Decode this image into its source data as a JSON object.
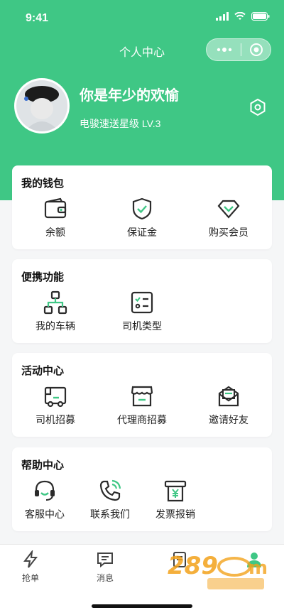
{
  "status": {
    "time": "9:41"
  },
  "header": {
    "title": "个人中心"
  },
  "profile": {
    "name": "你是年少的欢愉",
    "level": "电骏速送星级 LV.3"
  },
  "wallet": {
    "title": "我的钱包",
    "items": [
      {
        "label": "余额",
        "icon": "wallet-icon"
      },
      {
        "label": "保证金",
        "icon": "shield-check-icon"
      },
      {
        "label": "购买会员",
        "icon": "diamond-icon"
      }
    ]
  },
  "tools": {
    "title": "便携功能",
    "items": [
      {
        "label": "我的车辆",
        "icon": "org-chart-icon"
      },
      {
        "label": "司机类型",
        "icon": "checklist-icon"
      }
    ]
  },
  "events": {
    "title": "活动中心",
    "items": [
      {
        "label": "司机招募",
        "icon": "truck-icon"
      },
      {
        "label": "代理商招募",
        "icon": "store-icon"
      },
      {
        "label": "邀请好友",
        "icon": "mail-icon"
      }
    ]
  },
  "help": {
    "title": "帮助中心",
    "items": [
      {
        "label": "客服中心",
        "icon": "headset-icon"
      },
      {
        "label": "联系我们",
        "icon": "phone-icon"
      },
      {
        "label": "发票报销",
        "icon": "invoice-icon"
      }
    ]
  },
  "tabs": [
    {
      "label": "抢单",
      "icon": "lightning-icon"
    },
    {
      "label": "消息",
      "icon": "message-icon"
    },
    {
      "label": "",
      "icon": "document-icon"
    },
    {
      "label": "",
      "icon": "person-icon"
    }
  ],
  "colors": {
    "brand": "#3fc785",
    "icon": "#2b2b2b",
    "accent": "#3fc785"
  }
}
